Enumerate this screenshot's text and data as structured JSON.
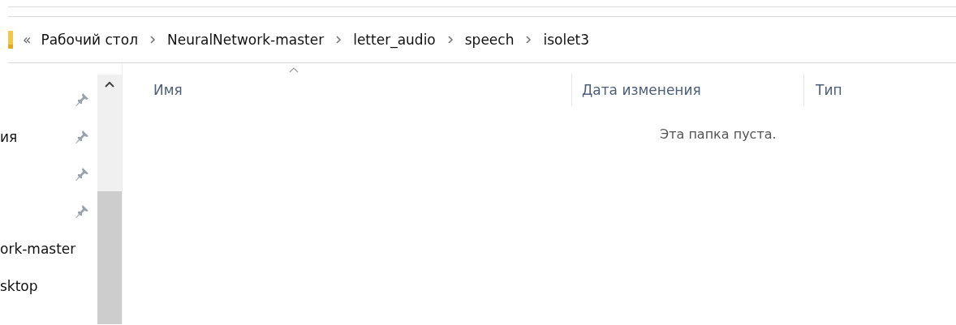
{
  "address_bar": {
    "overflow": "«",
    "path": [
      "Рабочий стол",
      "NeuralNetwork-master",
      "letter_audio",
      "speech",
      "isolet3"
    ]
  },
  "sidebar": {
    "items": [
      {
        "pinned": true
      },
      {
        "label": "ия",
        "pinned": true
      },
      {
        "pinned": true
      },
      {
        "pinned": true
      },
      {
        "label": "ork-master",
        "pinned": false
      },
      {
        "label": "sktop",
        "pinned": false
      }
    ]
  },
  "file_list": {
    "columns": [
      {
        "label": "Имя",
        "sorted": true
      },
      {
        "label": "Дата изменения",
        "sorted": false
      },
      {
        "label": "Тип",
        "sorted": false
      }
    ],
    "empty_message": "Эта папка пуста."
  }
}
